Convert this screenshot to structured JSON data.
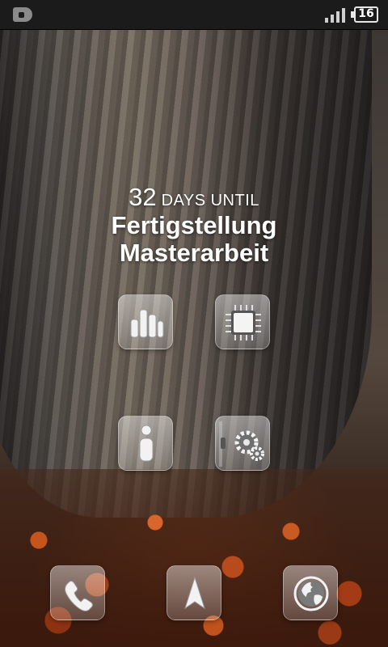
{
  "status_bar": {
    "battery_level": "16",
    "icons": [
      "lock-icon",
      "signal-icon",
      "battery-icon"
    ]
  },
  "countdown": {
    "days": "32",
    "unit_label": "DAYS UNTIL",
    "event_line1": "Fertigstellung",
    "event_line2": "Masterarbeit"
  },
  "home_icons": [
    "bar-chart-icon",
    "processor-icon",
    "info-icon",
    "settings-gears-icon"
  ],
  "dock_icons": [
    "phone-icon",
    "navigation-arrow-icon",
    "globe-icon"
  ]
}
